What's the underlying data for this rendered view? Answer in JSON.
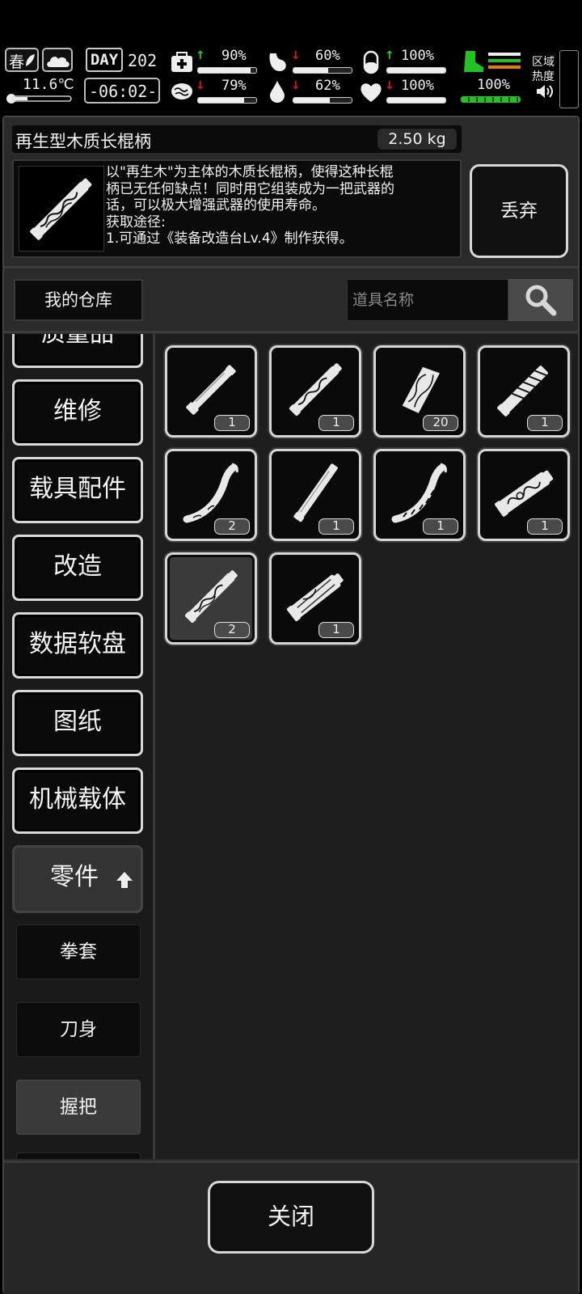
{
  "status": {
    "season": "春",
    "temperature": "11.6℃",
    "day_label": "DAY",
    "day_number": "202",
    "time": "-06:02-",
    "stats_row1": [
      {
        "icon": "first-aid-icon",
        "trend": "up",
        "value": "90%",
        "level": 0.9
      },
      {
        "icon": "stomach-icon",
        "trend": "down",
        "value": "60%",
        "level": 0.6
      },
      {
        "icon": "capsule-icon",
        "trend": "up",
        "value": "100%",
        "level": 1.0
      }
    ],
    "stats_row2": [
      {
        "icon": "brain-icon",
        "trend": "down",
        "value": "79%",
        "level": 0.79
      },
      {
        "icon": "water-drop-icon",
        "trend": "down",
        "value": "62%",
        "level": 0.62
      },
      {
        "icon": "heart-icon",
        "trend": "down",
        "value": "100%",
        "level": 1.0
      }
    ],
    "stamina_value": "100%",
    "region_heat_label_1": "区域",
    "region_heat_label_2": "热度",
    "colors": {
      "up": "#27d02a",
      "down": "#e01818",
      "boot": "#23c223",
      "stripe_orange": "#e87a12"
    }
  },
  "selected_item": {
    "name": "再生型木质长棍柄",
    "weight": "2.50 kg",
    "description": "以\"再生木\"为主体的木质长棍柄，使得这种长棍\n柄已无任何缺点！同时用它组装成为一把武器的\n话，可以极大增强武器的使用寿命。\n获取途径:\n1.可通过《装备改造台Lv.4》制作获得。",
    "discard_label": "丢弃"
  },
  "toolbar": {
    "warehouse_label": "我的仓库",
    "search_placeholder": "道具名称"
  },
  "categories": [
    {
      "label": "质量品"
    },
    {
      "label": "维修"
    },
    {
      "label": "载具配件"
    },
    {
      "label": "改造"
    },
    {
      "label": "数据软盘"
    },
    {
      "label": "图纸"
    },
    {
      "label": "机械载体"
    },
    {
      "label": "零件"
    }
  ],
  "subcategories": [
    {
      "label": "拳套"
    },
    {
      "label": "刀身"
    },
    {
      "label": "握把"
    }
  ],
  "items": [
    {
      "icon": "plain-rod-icon",
      "count": "1"
    },
    {
      "icon": "patterned-rod-icon",
      "count": "1"
    },
    {
      "icon": "wood-chunk-icon",
      "count": "20"
    },
    {
      "icon": "wrapped-grip-icon",
      "count": "1"
    },
    {
      "icon": "curved-handle-icon",
      "count": "2"
    },
    {
      "icon": "slim-rod-icon",
      "count": "1"
    },
    {
      "icon": "curved-patterned-handle-icon",
      "count": "1"
    },
    {
      "icon": "ornate-grip-icon",
      "count": "1"
    },
    {
      "icon": "regenerative-wood-staff-icon",
      "count": "2"
    },
    {
      "icon": "metal-grip-icon",
      "count": "1"
    }
  ],
  "footer": {
    "close_label": "关闭"
  }
}
